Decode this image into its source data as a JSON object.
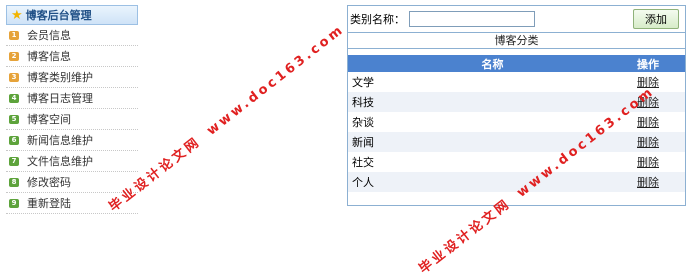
{
  "sidebar": {
    "title": "博客后台管理",
    "items": [
      {
        "num": "1",
        "label": "会员信息",
        "color": "#e6a33a"
      },
      {
        "num": "2",
        "label": "博客信息",
        "color": "#e6a33a"
      },
      {
        "num": "3",
        "label": "博客类别维护",
        "color": "#e6a33a"
      },
      {
        "num": "4",
        "label": "博客日志管理",
        "color": "#5da33b"
      },
      {
        "num": "5",
        "label": "博客空间",
        "color": "#5da33b"
      },
      {
        "num": "6",
        "label": "新闻信息维护",
        "color": "#5da33b"
      },
      {
        "num": "7",
        "label": "文件信息维护",
        "color": "#5da33b"
      },
      {
        "num": "8",
        "label": "修改密码",
        "color": "#5da33b"
      },
      {
        "num": "9",
        "label": "重新登陆",
        "color": "#5da33b"
      }
    ]
  },
  "form": {
    "label": "类别名称：",
    "value": "",
    "add_button": "添加"
  },
  "table": {
    "caption": "博客分类",
    "headers": {
      "name": "名称",
      "action": "操作"
    },
    "rows": [
      {
        "name": "文学",
        "action": "删除"
      },
      {
        "name": "科技",
        "action": "删除"
      },
      {
        "name": "杂谈",
        "action": "删除"
      },
      {
        "name": "新闻",
        "action": "删除"
      },
      {
        "name": "社交",
        "action": "删除"
      },
      {
        "name": "个人",
        "action": "删除"
      }
    ]
  },
  "watermark": {
    "cn": "毕业设计论文网",
    "url": "www.doc163.com"
  }
}
